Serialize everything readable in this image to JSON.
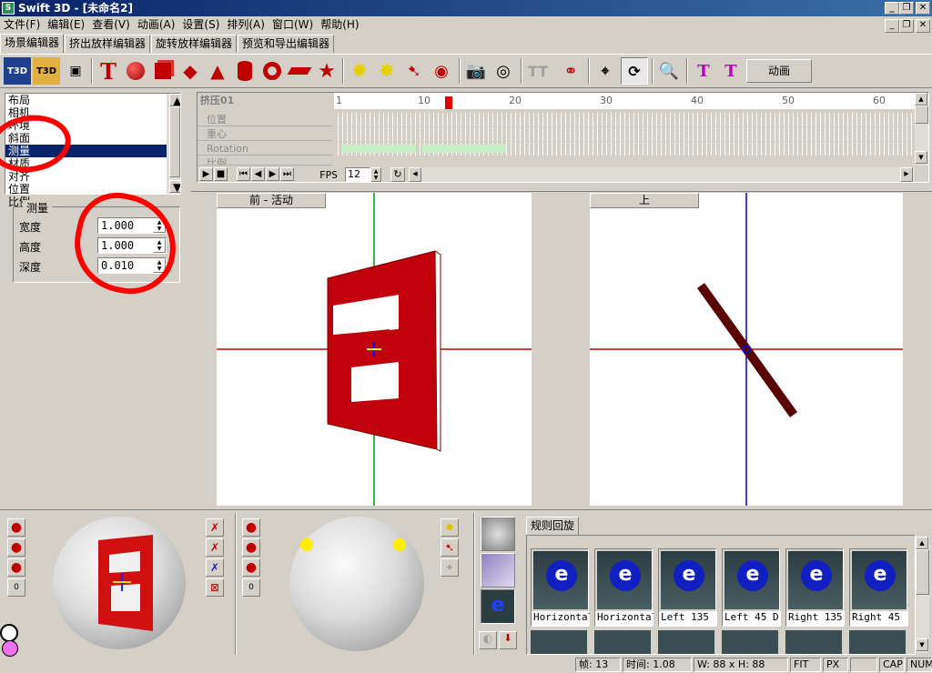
{
  "window": {
    "title": "Swift 3D - [未命名2]",
    "app_icon": "S"
  },
  "menu": [
    "文件(F)",
    "编辑(E)",
    "查看(V)",
    "动画(A)",
    "设置(S)",
    "排列(A)",
    "窗口(W)",
    "帮助(H)"
  ],
  "tabs": [
    "场景编辑器",
    "挤出放样编辑器",
    "旋转放样编辑器",
    "预览和导出编辑器"
  ],
  "toolbar": {
    "animate_label": "动画"
  },
  "property_list": {
    "items": [
      "布局",
      "相机",
      "环境",
      "斜面",
      "测量",
      "材质",
      "对齐",
      "位置",
      "比例"
    ],
    "selected": "测量"
  },
  "measure": {
    "legend": "测量",
    "fields": [
      {
        "label": "宽度",
        "value": "1.000"
      },
      {
        "label": "高度",
        "value": "1.000"
      },
      {
        "label": "深度",
        "value": "0.010"
      }
    ]
  },
  "timeline": {
    "object": "挤压01",
    "rows": [
      "位置",
      "重心",
      "Rotation",
      "比例"
    ],
    "ruler_labels": [
      "1",
      "10",
      "20",
      "30",
      "40",
      "50",
      "60"
    ],
    "current_frame": 13,
    "fps_label": "FPS",
    "fps_value": "12"
  },
  "viewports": {
    "front": "前 - 活动",
    "top": "上"
  },
  "gallery": {
    "tab": "规则回旋",
    "items": [
      "Horizontal",
      "Horizontal",
      "Left 135",
      "Left 45 D",
      "Right 135",
      "Right 45"
    ]
  },
  "status": {
    "frame": "帧: 13",
    "time": "时间: 1.08",
    "size": "W: 88 x H: 88",
    "fit": "FIT",
    "px": "PX",
    "cap": "CAP",
    "num": "NUM"
  },
  "colors": {
    "accent": "#0a246a",
    "object": "#c0000a",
    "annotation": "#ff0000"
  }
}
